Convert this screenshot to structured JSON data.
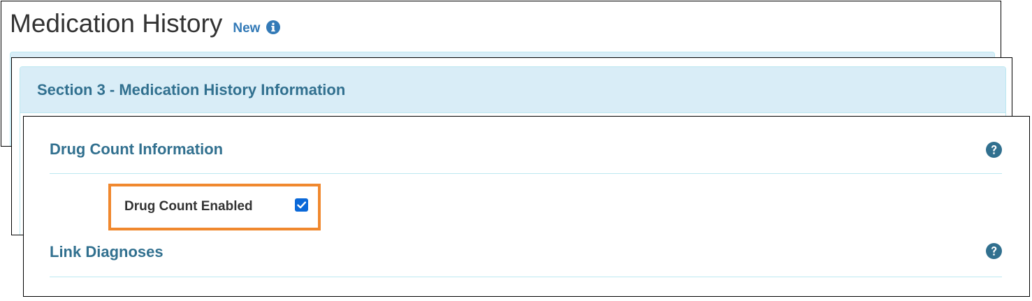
{
  "page": {
    "title": "Medication History",
    "new_label": "New"
  },
  "section": {
    "title": "Section 3 - Medication History Information"
  },
  "groups": {
    "drug_count": {
      "title": "Drug Count Information"
    },
    "link_diagnoses": {
      "title": "Link Diagnoses"
    }
  },
  "fields": {
    "drug_count_enabled": {
      "label": "Drug Count Enabled",
      "checked": true
    }
  },
  "icons": {
    "info": "info-circle-icon",
    "help": "question-circle-icon"
  },
  "colors": {
    "heading_text": "#31708f",
    "panel_bg": "#d9edf7",
    "panel_border": "#bce8f1",
    "link": "#337ab7",
    "highlight": "#f0882e",
    "checkbox": "#0a68d8"
  }
}
